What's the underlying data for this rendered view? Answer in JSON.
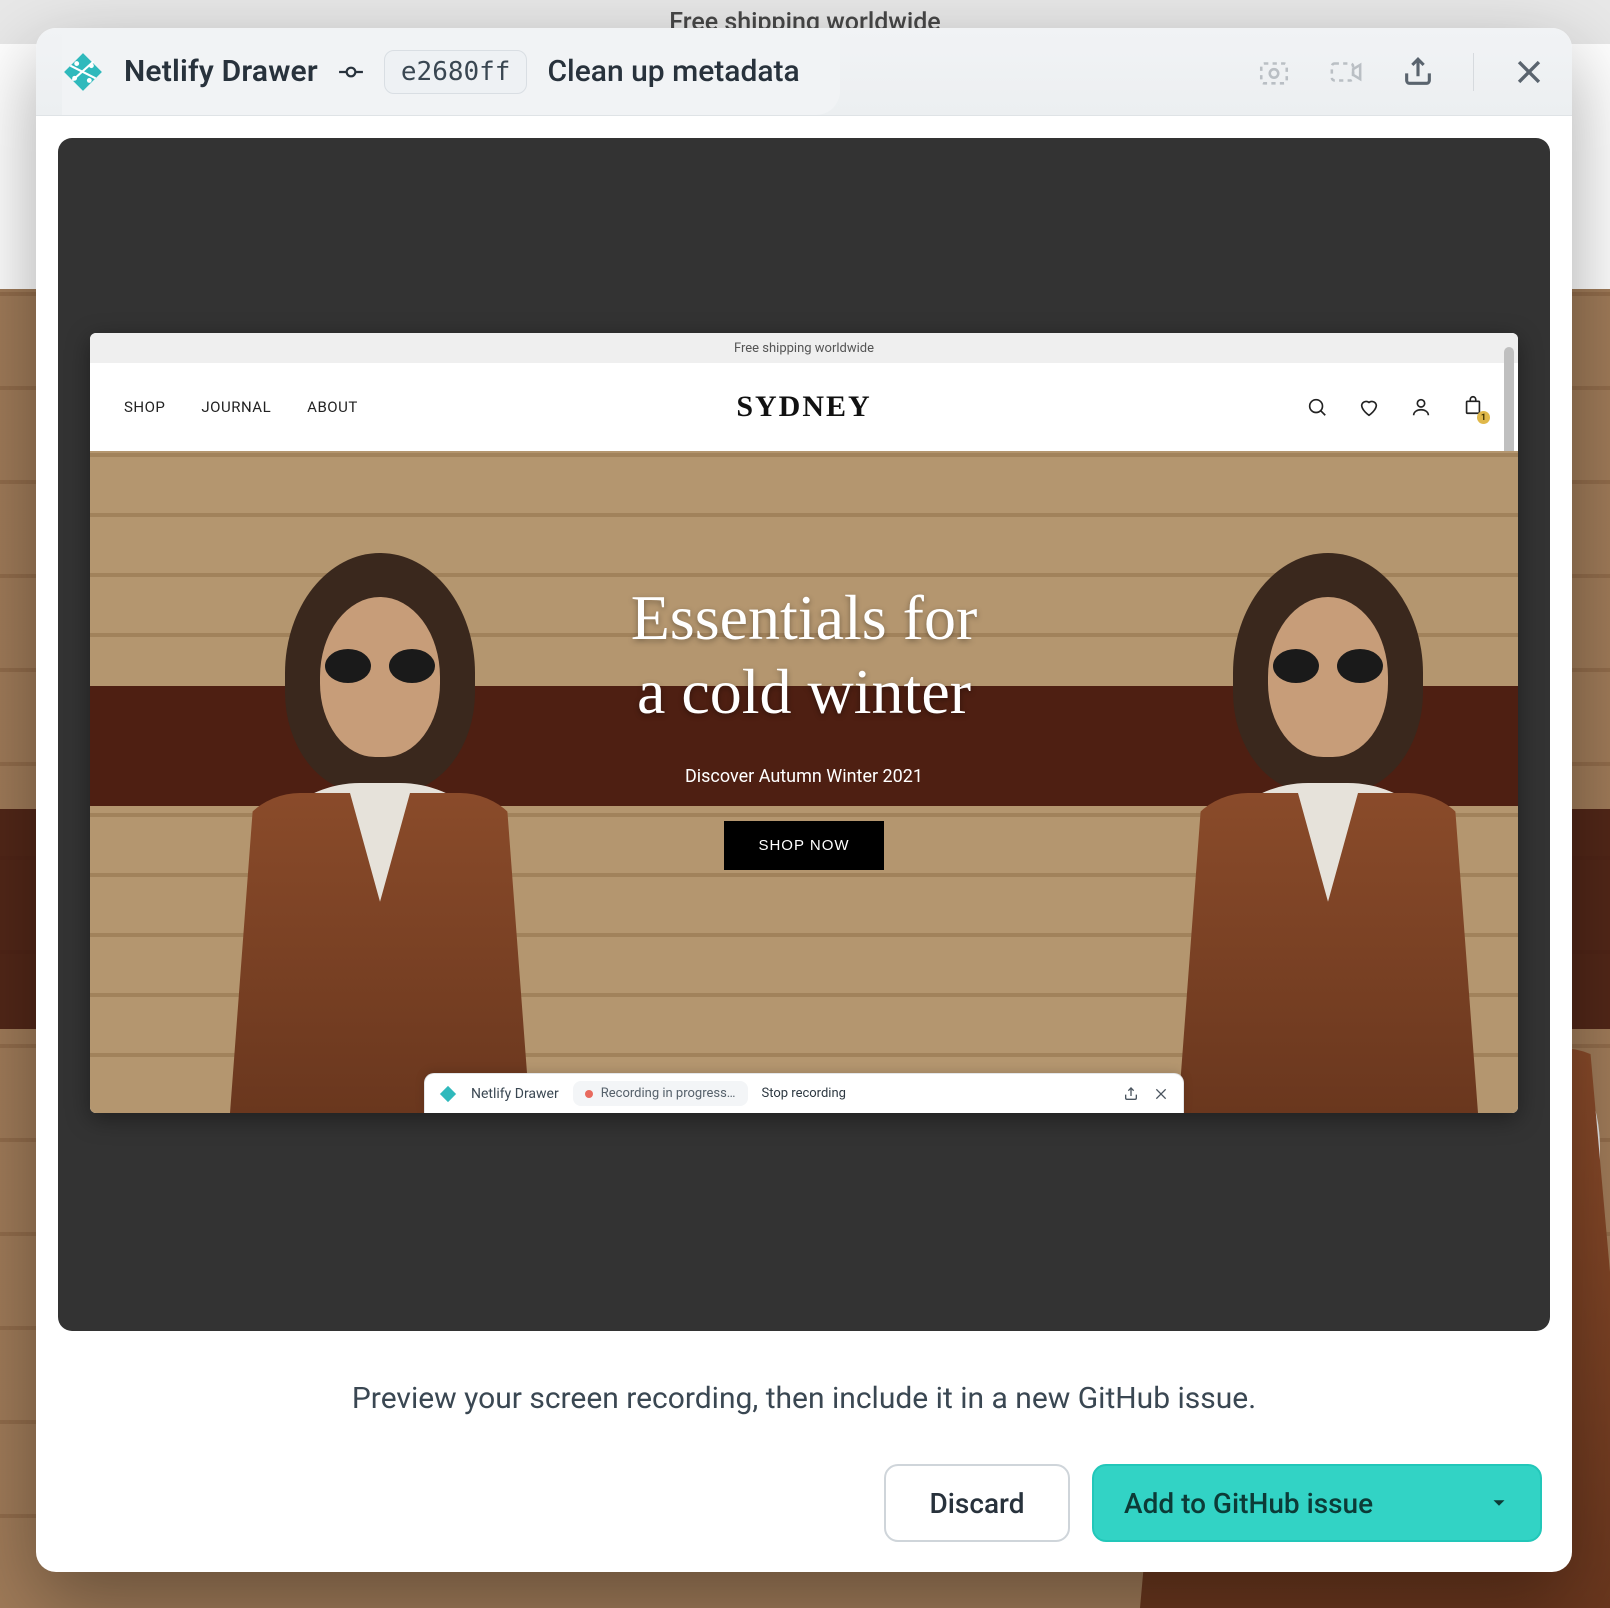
{
  "background": {
    "banner": "Free shipping worldwide"
  },
  "dialog": {
    "app_name": "Netlify Drawer",
    "commit_hash": "e2680ff",
    "commit_message": "Clean up metadata",
    "instruction": "Preview your screen recording, then include it in a new GitHub issue.",
    "discard_label": "Discard",
    "add_label": "Add to GitHub issue"
  },
  "screenshot": {
    "banner": "Free shipping worldwide",
    "nav": {
      "items": [
        "SHOP",
        "JOURNAL",
        "ABOUT"
      ],
      "brand": "SYDNEY",
      "bag_count": "1"
    },
    "hero": {
      "headline_l1": "Essentials for",
      "headline_l2": "a cold winter",
      "subhead": "Discover Autumn Winter 2021",
      "cta": "SHOP NOW"
    },
    "mini_drawer": {
      "app_name": "Netlify Drawer",
      "recording_status": "Recording in progress…",
      "stop_label": "Stop recording"
    }
  }
}
